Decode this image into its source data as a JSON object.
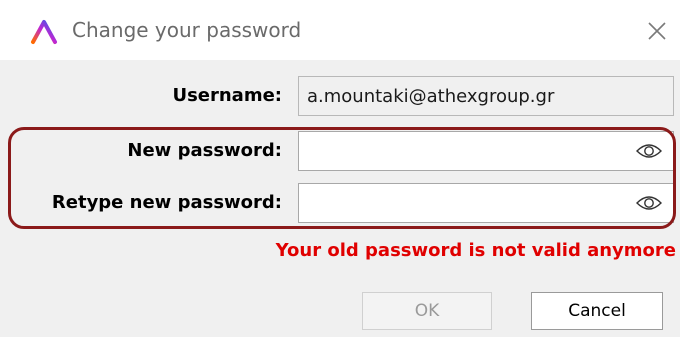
{
  "dialog": {
    "title": "Change your password",
    "brand_colors": [
      "#ff6a00",
      "#c026d3",
      "#2563eb"
    ]
  },
  "form": {
    "username_label": "Username:",
    "username_value": "a.mountaki@athexgroup.gr",
    "new_password_label": "New password:",
    "new_password_value": "",
    "retype_password_label": "Retype new password:",
    "retype_password_value": "",
    "error_message": "Your old password is not valid anymore",
    "error_color": "#e00000",
    "highlight_color": "#8b1a1a"
  },
  "buttons": {
    "ok_label": "OK",
    "ok_enabled": false,
    "cancel_label": "Cancel"
  },
  "icons": {
    "app": "app-logo-icon",
    "close": "close-icon",
    "reveal": "eye-icon"
  }
}
